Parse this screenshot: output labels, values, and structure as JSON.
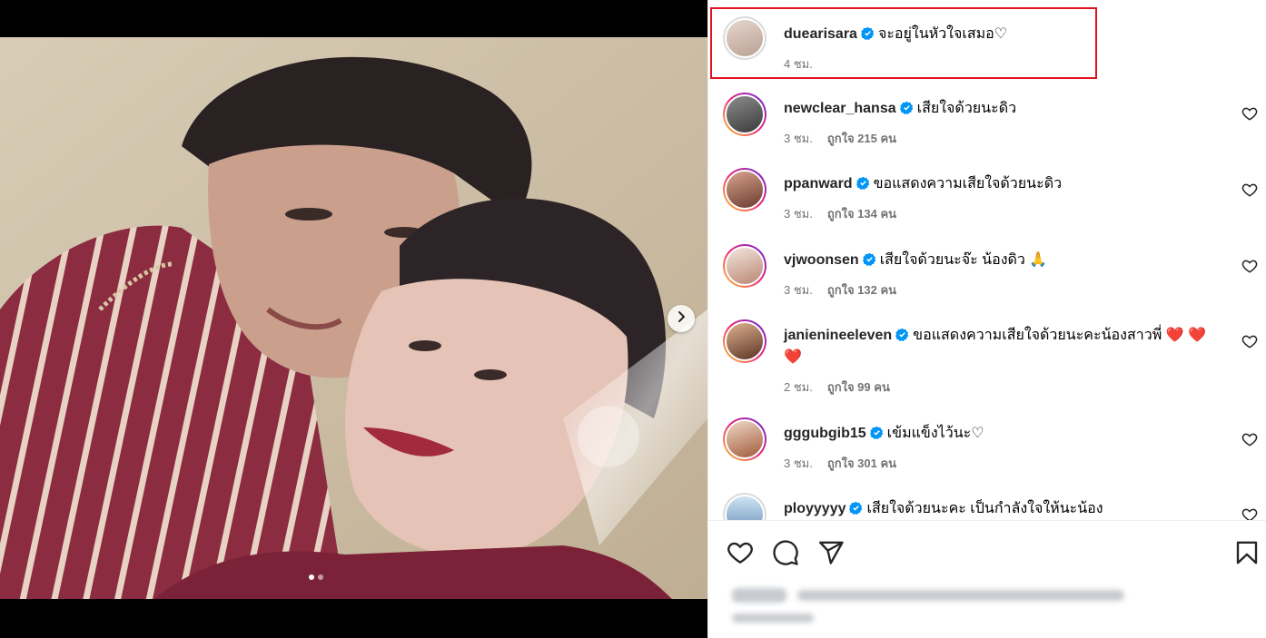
{
  "post": {
    "caption_author": "duearisara",
    "caption_text": "จะอยู่ในหัวใจเสมอ♡",
    "caption_time": "4 ชม.",
    "carousel_total": 2,
    "carousel_index": 1
  },
  "comments": [
    {
      "username": "newclear_hansa",
      "verified": true,
      "text": "เสียใจด้วยนะดิว",
      "time": "3 ชม.",
      "likes": "ถูกใจ 215 คน"
    },
    {
      "username": "ppanward",
      "verified": true,
      "text": "ขอแสดงความเสียใจด้วยนะดิว",
      "time": "3 ชม.",
      "likes": "ถูกใจ 134 คน"
    },
    {
      "username": "vjwoonsen",
      "verified": true,
      "text": "เสียใจด้วยนะจ๊ะ น้องดิว 🙏",
      "time": "3 ชม.",
      "likes": "ถูกใจ 132 คน"
    },
    {
      "username": "janienineeleven",
      "verified": true,
      "text": "ขอแสดงความเสียใจด้วยนะคะน้องสาวพี่ ❤️ ❤️ ❤️",
      "time": "2 ชม.",
      "likes": "ถูกใจ 99 คน"
    },
    {
      "username": "gggubgib15",
      "verified": true,
      "text": "เข้มแข็งไว้นะ♡",
      "time": "3 ชม.",
      "likes": "ถูกใจ 301 คน"
    },
    {
      "username": "ployyyyy",
      "verified": true,
      "text": "เสียใจด้วยนะคะ เป็นกำลังใจให้นะน้อง",
      "time": "",
      "likes": ""
    }
  ],
  "icons": {
    "like": "heart-outline-icon",
    "comment": "comment-bubble-icon",
    "share": "paper-plane-icon",
    "save": "bookmark-icon",
    "verified": "verified-badge-icon",
    "next": "chevron-right-icon"
  },
  "colors": {
    "highlight": "#e0141e",
    "verified": "#0095f6",
    "meta_text": "#737373"
  }
}
